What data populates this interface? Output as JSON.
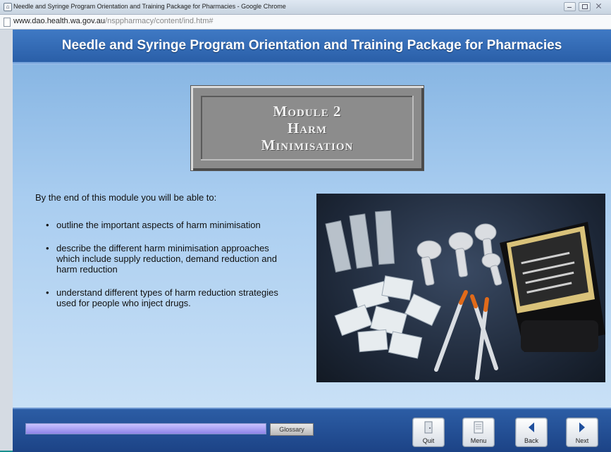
{
  "window": {
    "title": "Needle and Syringe Program Orientation and Training Package for Pharmacies - Google Chrome",
    "url_host": "www.dao.health.wa.gov.au",
    "url_path": "/nsppharmacy/content/ind.htm#"
  },
  "header": {
    "title": "Needle and Syringe Program Orientation and Training Package for Pharmacies"
  },
  "module": {
    "line1": "Module 2",
    "line2": "Harm",
    "line3": "Minimisation"
  },
  "content": {
    "intro": "By the end of this module you will be able to:",
    "bullets": [
      "outline the important aspects of harm minimisation",
      "describe the different harm minimisation approaches which include supply reduction, demand reduction and harm reduction",
      "understand different types of harm reduction strategies used for people who inject drugs."
    ]
  },
  "footer": {
    "progress_fraction": 1.0,
    "glossary_label": "Glossary",
    "buttons": {
      "quit": "Quit",
      "menu": "Menu",
      "back": "Back",
      "next": "Next"
    }
  },
  "colors": {
    "header_blue": "#2a5fa8",
    "footer_blue": "#1c4386",
    "background_teal": "#1a8f8f"
  }
}
